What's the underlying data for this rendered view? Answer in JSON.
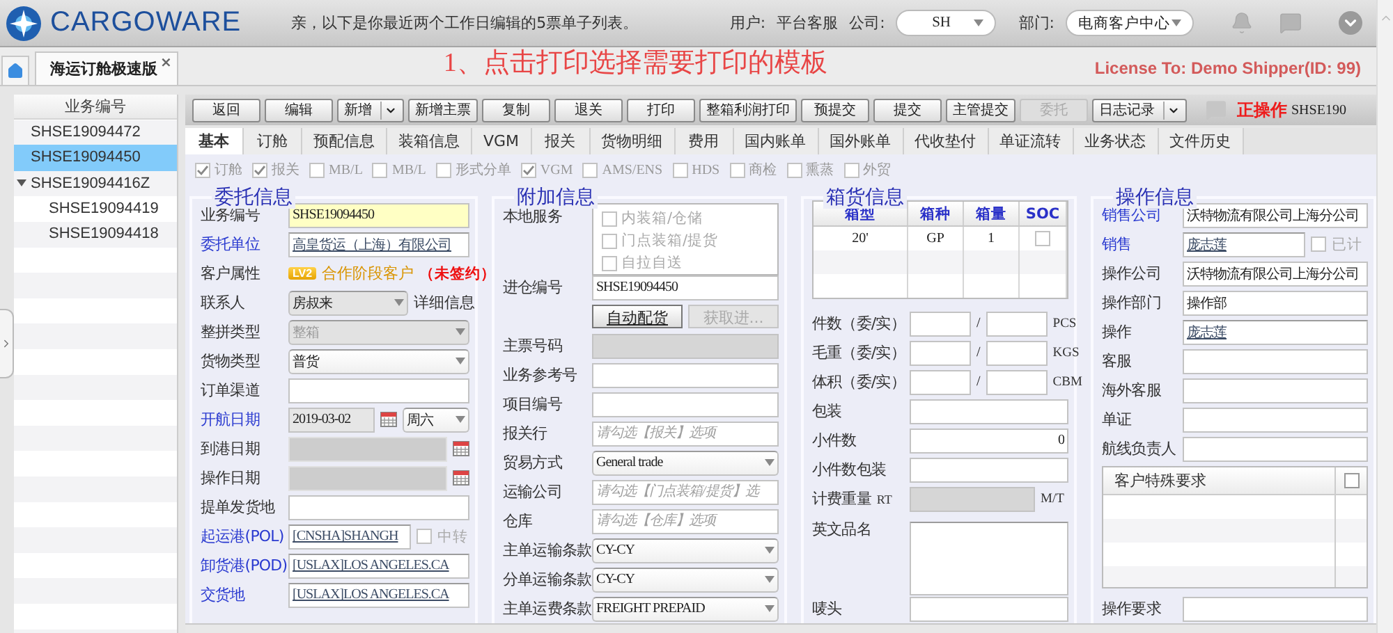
{
  "header": {
    "brand": "CARGOWARE",
    "message": "亲，以下是你最近两个工作日编辑的5票单子列表。",
    "user_label": "用户:",
    "user": "平台客服",
    "company_label": "公司:",
    "company": "SH",
    "department_label": "部门:",
    "department": "电商客户中心"
  },
  "doc_tabs": [
    {
      "label": "海运订舱极速版",
      "close": "×",
      "selected": true
    }
  ],
  "annotation": "1、点击打印选择需要打印的模板",
  "license": "License To: Demo Shipper(ID: 99)",
  "order_list": {
    "column": "业务编号",
    "items": [
      {
        "label": "SHSE19094472",
        "selected": false
      },
      {
        "label": "SHSE19094450",
        "selected": true
      },
      {
        "label": "SHSE19094416Z",
        "selected": false,
        "expanded": true,
        "children": [
          {
            "label": "SHSE19094419",
            "selected": false
          },
          {
            "label": "SHSE19094418",
            "selected": false
          }
        ]
      }
    ]
  },
  "toolbar": {
    "buttons": [
      {
        "label": "返回",
        "kind": "button",
        "disabled": false
      },
      {
        "label": "编辑",
        "kind": "button",
        "disabled": false
      },
      {
        "label": "新增",
        "kind": "split",
        "disabled": false
      },
      {
        "label": "新增主票",
        "kind": "button",
        "disabled": false
      },
      {
        "label": "复制",
        "kind": "button",
        "disabled": false
      },
      {
        "label": "退关",
        "kind": "button",
        "disabled": false
      },
      {
        "label": "打印",
        "kind": "button",
        "disabled": false
      },
      {
        "label": "整箱利润打印",
        "kind": "button",
        "disabled": false
      },
      {
        "label": "预提交",
        "kind": "button",
        "disabled": false
      },
      {
        "label": "提交",
        "kind": "button",
        "disabled": false
      },
      {
        "label": "主管提交",
        "kind": "button",
        "disabled": false
      },
      {
        "label": "委托",
        "kind": "button",
        "disabled": true
      },
      {
        "label": "日志记录",
        "kind": "split",
        "disabled": false
      }
    ],
    "status": "正操作",
    "status_ref": "SHSE190"
  },
  "tabs": [
    {
      "label": "基本",
      "selected": true
    },
    {
      "label": "订舱",
      "selected": false
    },
    {
      "label": "预配信息",
      "selected": false
    },
    {
      "label": "装箱信息",
      "selected": false
    },
    {
      "label": "VGM",
      "selected": false
    },
    {
      "label": "报关",
      "selected": false
    },
    {
      "label": "货物明细",
      "selected": false
    },
    {
      "label": "费用",
      "selected": false
    },
    {
      "label": "国内账单",
      "selected": false
    },
    {
      "label": "国外账单",
      "selected": false
    },
    {
      "label": "代收垫付",
      "selected": false
    },
    {
      "label": "单证流转",
      "selected": false
    },
    {
      "label": "业务状态",
      "selected": false
    },
    {
      "label": "文件历史",
      "selected": false
    }
  ],
  "options": [
    {
      "label": "订舱",
      "checked": true
    },
    {
      "label": "报关",
      "checked": true
    },
    {
      "label": "MB/L",
      "checked": false
    },
    {
      "label": "MB/L",
      "checked": false
    },
    {
      "label": "形式分单",
      "checked": false
    },
    {
      "label": "VGM",
      "checked": true
    },
    {
      "label": "AMS/ENS",
      "checked": false
    },
    {
      "label": "HDS",
      "checked": false
    },
    {
      "label": "商检",
      "checked": false
    },
    {
      "label": "熏蒸",
      "checked": false
    },
    {
      "label": "外贸",
      "checked": false
    }
  ],
  "panels": [
    {
      "title": "委托信息",
      "rows": [
        {
          "label": "业务编号",
          "emphasized": false,
          "kind": "text",
          "value": "SHSE19094450",
          "highlighted": true,
          "disabled": false
        },
        {
          "label": "委托单位",
          "emphasized": true,
          "kind": "link",
          "value": "高皇货运（上海）有限公司"
        },
        {
          "label": "客户属性",
          "emphasized": false,
          "kind": "badge",
          "badge": "LV2",
          "value": "合作阶段客户",
          "note": "（未签约）"
        },
        {
          "label": "联系人",
          "emphasized": false,
          "kind": "contact",
          "value": "房叔来",
          "action": "详细信息"
        },
        {
          "label": "整拼类型",
          "emphasized": false,
          "kind": "combo",
          "value": "整箱",
          "disabled": true
        },
        {
          "label": "货物类型",
          "emphasized": false,
          "kind": "combo",
          "value": "普货",
          "disabled": false
        },
        {
          "label": "订单渠道",
          "emphasized": false,
          "kind": "text",
          "disabled": false
        },
        {
          "label": "开航日期",
          "emphasized": true,
          "kind": "date",
          "value": "2019-03-02",
          "weekday": "周六",
          "disabled": false
        },
        {
          "label": "到港日期",
          "emphasized": false,
          "kind": "date",
          "disabled": true
        },
        {
          "label": "操作日期",
          "emphasized": false,
          "kind": "date",
          "disabled": true
        },
        {
          "label": "提单发货地",
          "emphasized": false,
          "kind": "text",
          "disabled": false
        },
        {
          "label": "起运港(POL)",
          "emphasized": true,
          "kind": "link",
          "value": "[CNSHA]SHANGH",
          "option": "中转",
          "checked": false
        },
        {
          "label": "卸货港(POD)",
          "emphasized": true,
          "kind": "link",
          "value": "[USLAX]LOS ANGELES.CA"
        },
        {
          "label": "交货地",
          "emphasized": true,
          "kind": "link",
          "value": "[USLAX]LOS ANGELES.CA"
        }
      ]
    },
    {
      "title": "附加信息",
      "rows": [
        {
          "label": "本地服务",
          "emphasized": false,
          "kind": "checklist",
          "items": [
            {
              "label": "内装箱/仓储",
              "checked": false
            },
            {
              "label": "门点装箱/提货",
              "checked": false
            },
            {
              "label": "自拉自送",
              "checked": false
            }
          ]
        },
        {
          "label": "进仓编号",
          "emphasized": false,
          "kind": "text",
          "value": "SHSE19094450",
          "disabled": false
        },
        {
          "kind": "buttons",
          "buttons": [
            {
              "label": "自动配货",
              "disabled": false
            },
            {
              "label": "获取进...",
              "disabled": true
            }
          ]
        },
        {
          "label": "主票号码",
          "emphasized": false,
          "kind": "text",
          "disabled": true
        },
        {
          "label": "业务参考号",
          "emphasized": false,
          "kind": "text",
          "disabled": false
        },
        {
          "label": "项目编号",
          "emphasized": false,
          "kind": "text",
          "disabled": false
        },
        {
          "label": "报关行",
          "emphasized": false,
          "kind": "text",
          "placeholder": "请勾选【报关】选项",
          "disabled": false
        },
        {
          "label": "贸易方式",
          "emphasized": false,
          "kind": "combo",
          "value": "General trade",
          "disabled": false
        },
        {
          "label": "运输公司",
          "emphasized": false,
          "kind": "text",
          "placeholder": "请勾选【门点装箱/提货】选",
          "disabled": false
        },
        {
          "label": "仓库",
          "emphasized": false,
          "kind": "text",
          "placeholder": "请勾选【仓库】选项",
          "disabled": false
        },
        {
          "label": "主单运输条款",
          "emphasized": false,
          "kind": "combo",
          "value": "CY-CY",
          "disabled": false
        },
        {
          "label": "分单运输条款",
          "emphasized": false,
          "kind": "combo",
          "value": "CY-CY",
          "disabled": false
        },
        {
          "label": "主单运费条款",
          "emphasized": false,
          "kind": "combo",
          "value": "FREIGHT PREPAID",
          "disabled": false
        }
      ]
    },
    {
      "title": "箱货信息",
      "rows": [
        {
          "kind": "table",
          "columns": [
            "箱型",
            "箱种",
            "箱量",
            "SOC"
          ],
          "rows": [
            {
              "cells": [
                "20'",
                "GP",
                "1"
              ],
              "checked": false
            }
          ]
        },
        {
          "label": "件数（委/实）",
          "emphasized": false,
          "kind": "pair",
          "separator": "/",
          "unit": "PCS"
        },
        {
          "label": "毛重（委/实）",
          "emphasized": false,
          "kind": "pair",
          "separator": "/",
          "unit": "KGS"
        },
        {
          "label": "体积（委/实）",
          "emphasized": false,
          "kind": "pair",
          "separator": "/",
          "unit": "CBM"
        },
        {
          "label": "包装",
          "emphasized": false,
          "kind": "text",
          "disabled": false
        },
        {
          "label": "小件数",
          "emphasized": false,
          "kind": "number",
          "value": "0",
          "disabled": false
        },
        {
          "label": "小件数包装",
          "emphasized": false,
          "kind": "text",
          "disabled": false
        },
        {
          "label": "计费重量",
          "sub": "RT",
          "emphasized": false,
          "kind": "text",
          "disabled": true,
          "unit": "M/T"
        },
        {
          "label": "英文品名",
          "emphasized": false,
          "kind": "textarea"
        },
        {
          "label": "唛头",
          "emphasized": false,
          "kind": "text",
          "disabled": false
        }
      ]
    },
    {
      "title": "操作信息",
      "rows": [
        {
          "label": "销售公司",
          "emphasized": true,
          "kind": "text",
          "value": "沃特物流有限公司上海分公司",
          "disabled": false
        },
        {
          "label": "销售",
          "emphasized": true,
          "kind": "link",
          "value": "庞志莲",
          "option": "已计",
          "checked": false
        },
        {
          "label": "操作公司",
          "emphasized": false,
          "kind": "text",
          "value": "沃特物流有限公司上海分公司",
          "disabled": false
        },
        {
          "label": "操作部门",
          "emphasized": false,
          "kind": "text",
          "value": "操作部",
          "disabled": false
        },
        {
          "label": "操作",
          "emphasized": false,
          "kind": "link",
          "value": "庞志莲"
        },
        {
          "label": "客服",
          "emphasized": false,
          "kind": "text",
          "disabled": false
        },
        {
          "label": "海外客服",
          "emphasized": false,
          "kind": "text",
          "disabled": false
        },
        {
          "label": "单证",
          "emphasized": false,
          "kind": "text",
          "disabled": false
        },
        {
          "label": "航线负责人",
          "emphasized": false,
          "kind": "text",
          "disabled": false
        },
        {
          "kind": "remarks",
          "title": "客户特殊要求",
          "checked": false
        },
        {
          "label": "操作要求",
          "emphasized": false,
          "kind": "text",
          "disabled": false
        }
      ]
    }
  ]
}
